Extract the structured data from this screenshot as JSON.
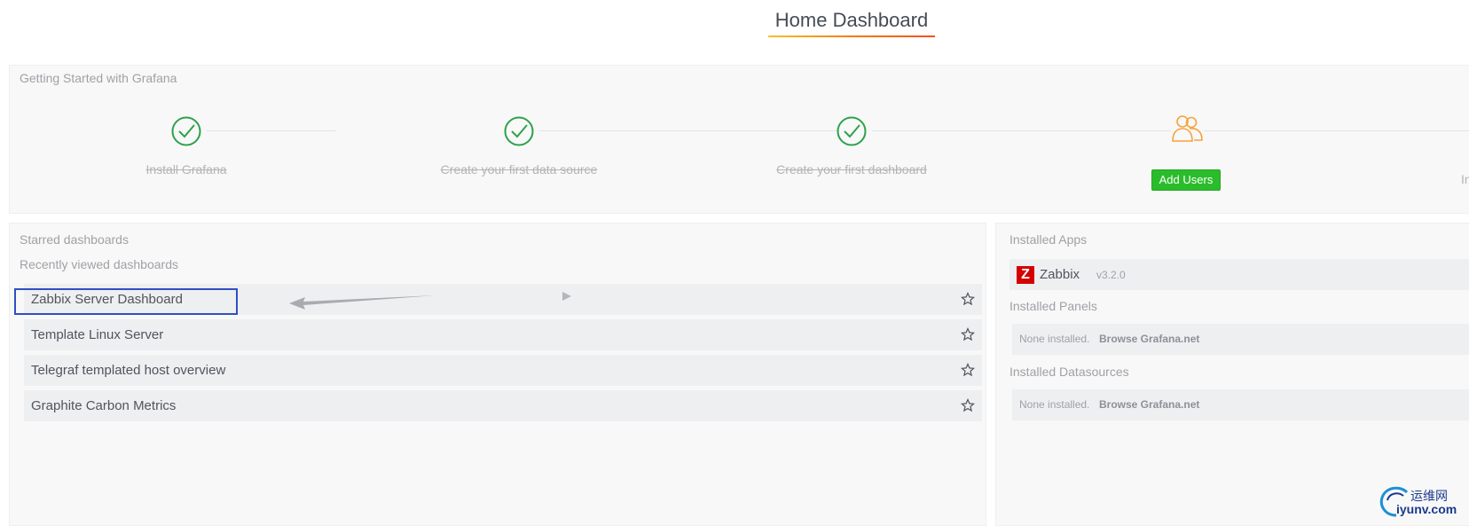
{
  "header": {
    "title": "Home Dashboard"
  },
  "getting_started": {
    "title": "Getting Started with Grafana",
    "steps": [
      {
        "label": "Install Grafana",
        "done": true
      },
      {
        "label": "Create your first data source",
        "done": true
      },
      {
        "label": "Create your first dashboard",
        "done": true
      }
    ],
    "add_users_label": "Add Users",
    "next_partial": "Ins"
  },
  "dashboards": {
    "starred_title": "Starred dashboards",
    "recent_title": "Recently viewed dashboards",
    "recent": [
      "Zabbix Server Dashboard",
      "Template Linux Server",
      "Telegraf templated host overview",
      "Graphite Carbon Metrics"
    ]
  },
  "plugins": {
    "apps_title": "Installed Apps",
    "apps": [
      {
        "logo": "Z",
        "name": "Zabbix",
        "version": "v3.2.0"
      }
    ],
    "panels_title": "Installed Panels",
    "panels_none": "None installed.",
    "panels_browse": "Browse Grafana.net",
    "datasources_title": "Installed Datasources",
    "datasources_none": "None installed.",
    "datasources_browse": "Browse Grafana.net"
  },
  "watermark": {
    "line1": "运维网",
    "line2": "iyunv.com"
  },
  "colors": {
    "success": "#2bbc2b",
    "pending": "#f7a23d",
    "highlight": "#2f4fc4"
  },
  "icons": {
    "step_done": "check-circle-icon",
    "step_pending": "users-icon",
    "star": "star-icon"
  }
}
